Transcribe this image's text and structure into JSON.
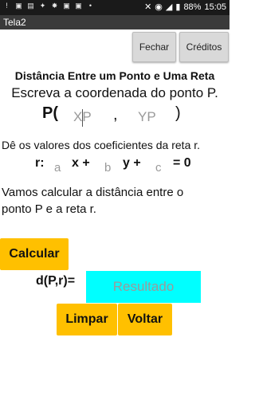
{
  "statusbar": {
    "battery": "88%",
    "time": "15:05"
  },
  "titlebar": {
    "title": "Tela2"
  },
  "buttons": {
    "fechar": "Fechar",
    "creditos": "Créditos",
    "calcular": "Calcular",
    "limpar": "Limpar",
    "voltar": "Voltar"
  },
  "headings": {
    "title": "Distância Entre um Ponto e Uma Reta",
    "subtitle": "Escreva a coordenada do ponto P."
  },
  "point": {
    "label": "P(",
    "comma": ",",
    "close": ")",
    "xp_hint": "XP",
    "yp_hint": "YP"
  },
  "line": {
    "instruction": "Dê os valores dos coeficientes da reta r.",
    "label": "r:",
    "a_hint": "a",
    "x_plus": "x +",
    "b_hint": "b",
    "y_plus": "y +",
    "c_hint": "c",
    "eq_zero": "= 0"
  },
  "description": {
    "line1": "Vamos calcular a distância entre o",
    "line2": "ponto P e a reta r."
  },
  "result": {
    "label": "d(P,r)=",
    "placeholder": "Resultado"
  }
}
